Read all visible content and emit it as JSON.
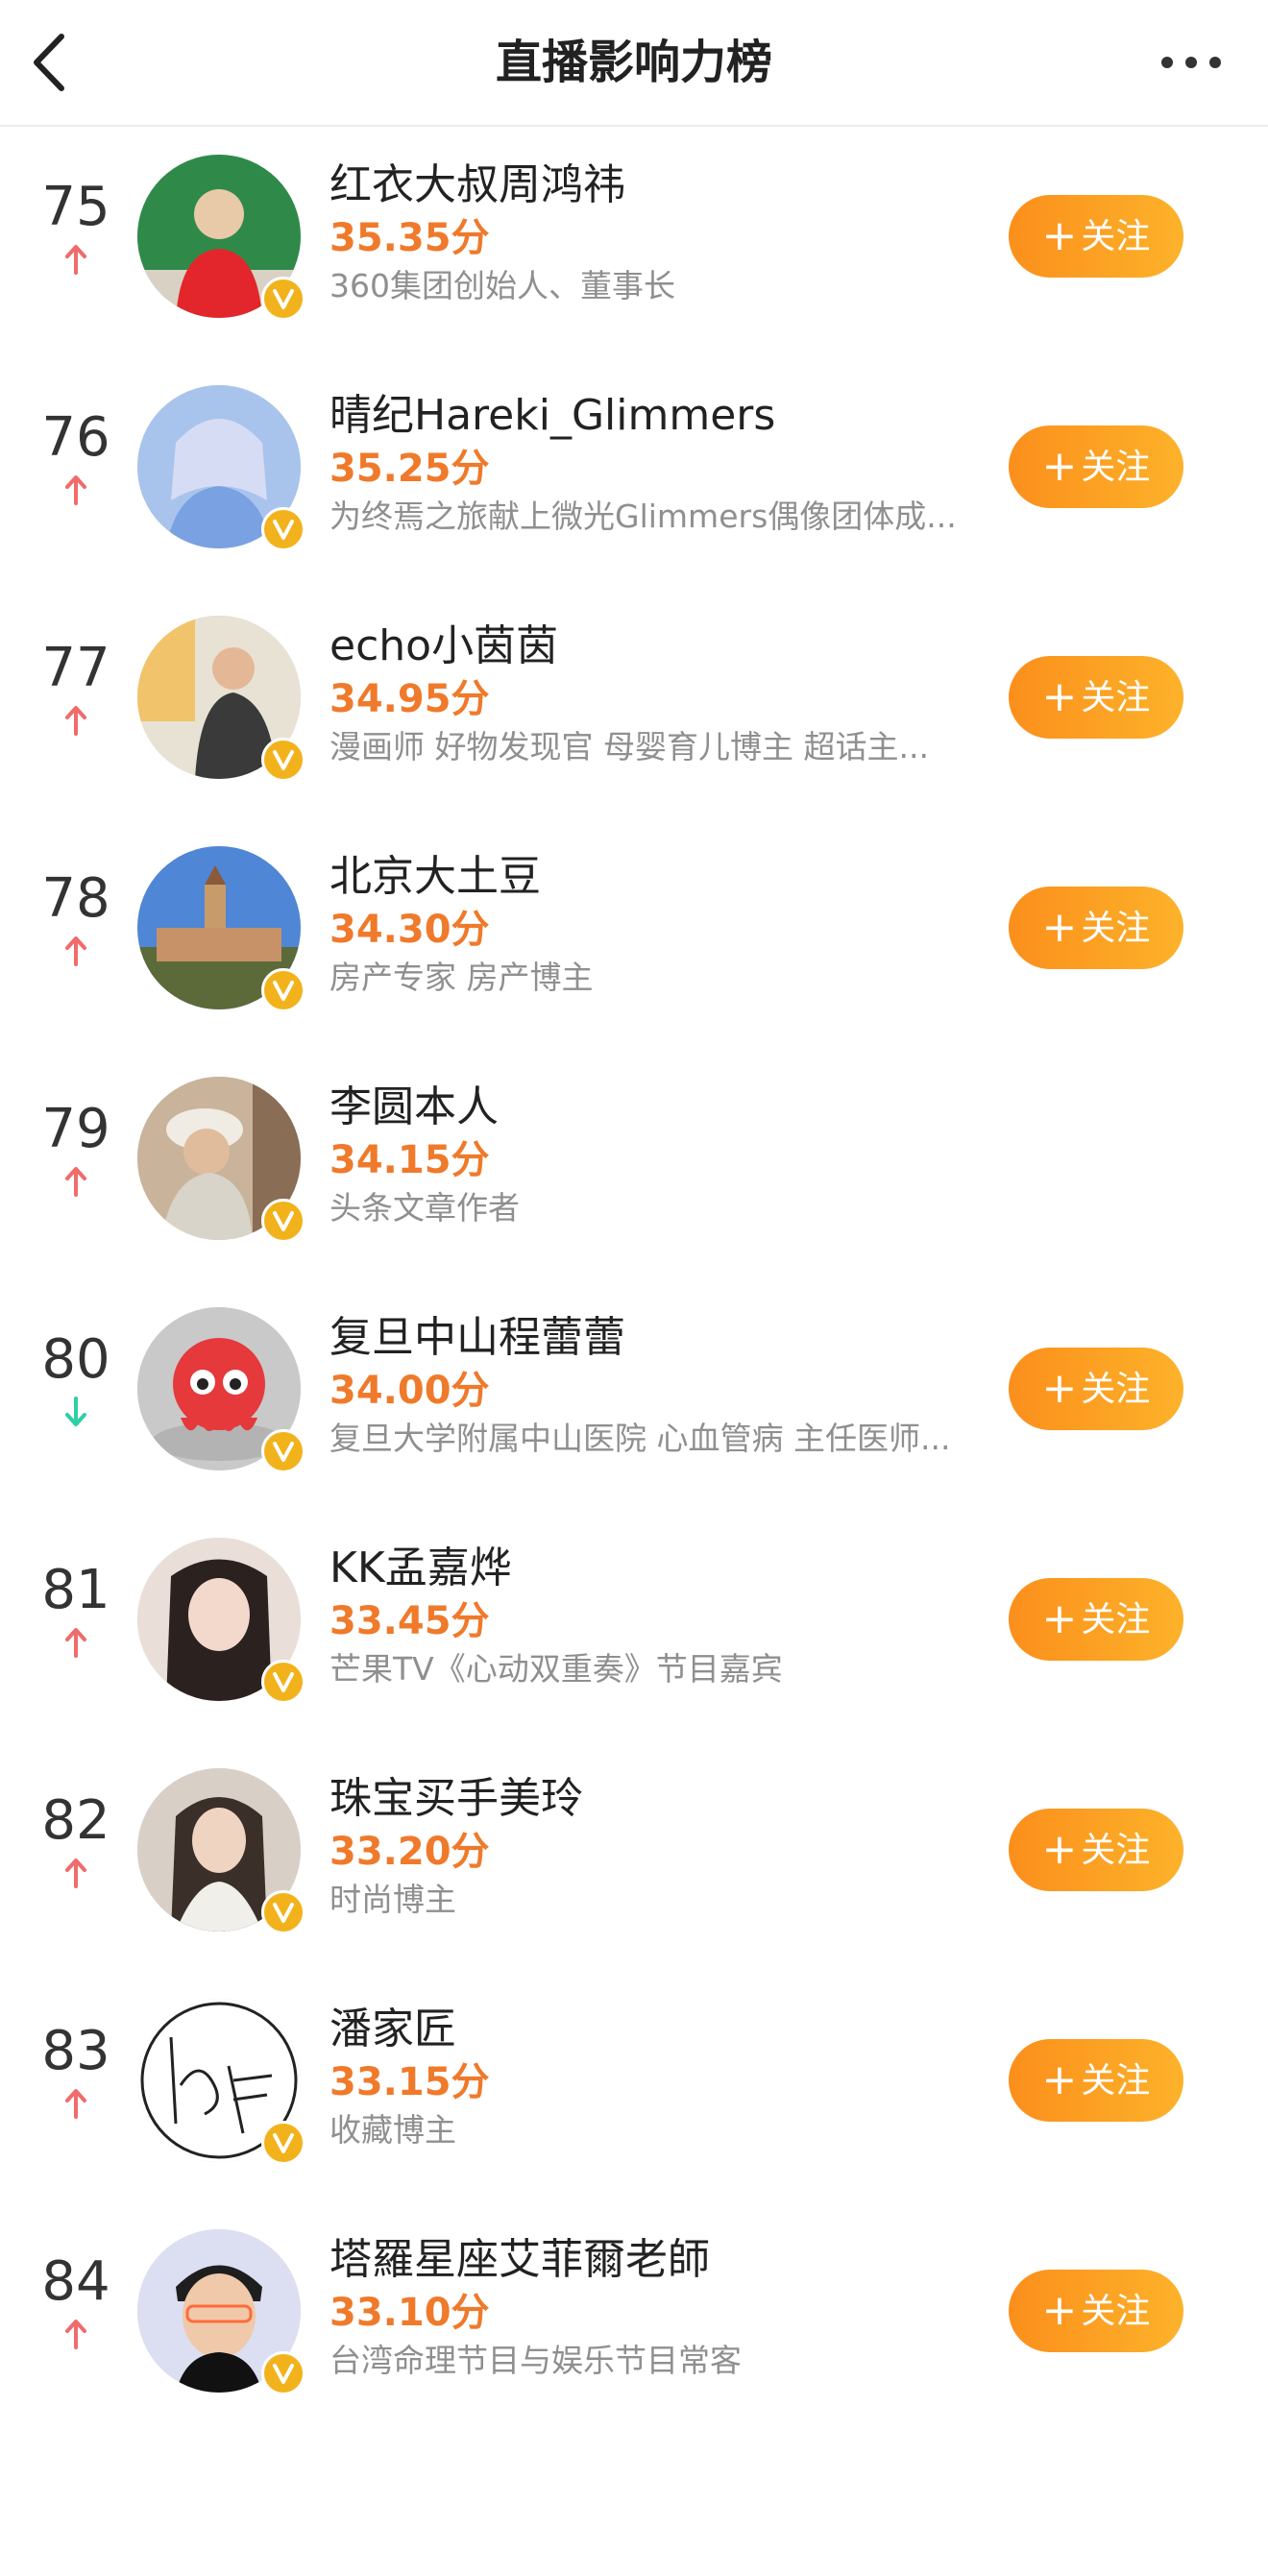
{
  "header": {
    "title": "直播影响力榜",
    "back_icon": "chevron-left-icon",
    "more_icon": "more-horizontal-icon"
  },
  "colors": {
    "score": "#ef7a2b",
    "follow_button": "#fb9a20",
    "trend_up": "#f06b6b",
    "trend_down": "#2ecfa6",
    "verified_badge": "#f2b21c"
  },
  "follow_label": "关注",
  "follow_plus": "+",
  "rankings": [
    {
      "rank": "75",
      "trend": "up",
      "name": "红衣大叔周鸿祎",
      "score": "35.35分",
      "desc": "360集团创始人、董事长",
      "follow": true
    },
    {
      "rank": "76",
      "trend": "up",
      "name": "晴纪Hareki_Glimmers",
      "score": "35.25分",
      "desc": "为终焉之旅献上微光Glimmers偶像团体成...",
      "follow": true
    },
    {
      "rank": "77",
      "trend": "up",
      "name": "echo小茵茵",
      "score": "34.95分",
      "desc": "漫画师 好物发现官 母婴育儿博主 超话主...",
      "follow": true
    },
    {
      "rank": "78",
      "trend": "up",
      "name": "北京大土豆",
      "score": "34.30分",
      "desc": "房产专家 房产博主",
      "follow": true
    },
    {
      "rank": "79",
      "trend": "up",
      "name": "李圆本人",
      "score": "34.15分",
      "desc": "头条文章作者",
      "follow": false
    },
    {
      "rank": "80",
      "trend": "down",
      "name": "复旦中山程蕾蕾",
      "score": "34.00分",
      "desc": "复旦大学附属中山医院 心血管病 主任医师...",
      "follow": true
    },
    {
      "rank": "81",
      "trend": "up",
      "name": "KK孟嘉烨",
      "score": "33.45分",
      "desc": "芒果TV《心动双重奏》节目嘉宾",
      "follow": true
    },
    {
      "rank": "82",
      "trend": "up",
      "name": "珠宝买手美玲",
      "score": "33.20分",
      "desc": "时尚博主",
      "follow": true
    },
    {
      "rank": "83",
      "trend": "up",
      "name": "潘家匠",
      "score": "33.15分",
      "desc": "收藏博主",
      "follow": true
    },
    {
      "rank": "84",
      "trend": "up",
      "name": "塔羅星座艾菲爾老師",
      "score": "33.10分",
      "desc": "台湾命理节目与娱乐节目常客",
      "follow": true
    }
  ]
}
